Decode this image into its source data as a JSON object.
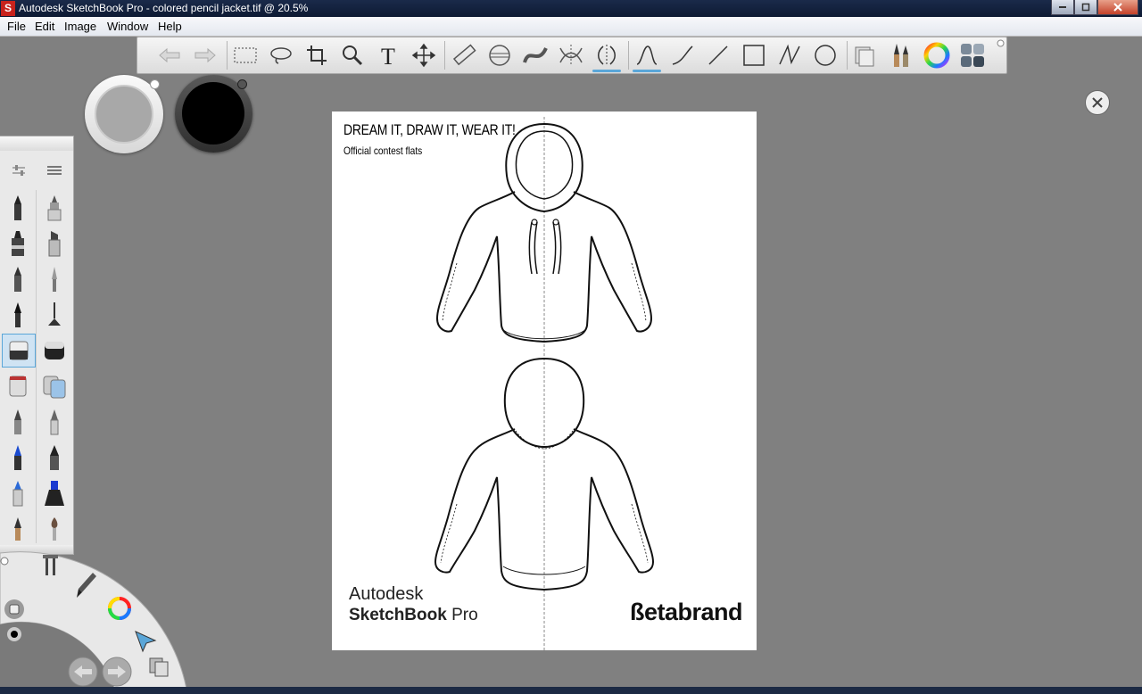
{
  "window": {
    "title": "Autodesk SketchBook Pro - colored pencil jacket.tif @ 20.5%",
    "app_icon": "S"
  },
  "menu": [
    "File",
    "Edit",
    "Image",
    "Window",
    "Help"
  ],
  "toolbar": {
    "tools": [
      "undo-icon",
      "redo-icon",
      "rect-select-icon",
      "lasso-icon",
      "crop-icon",
      "zoom-icon",
      "text-icon",
      "move-icon",
      "ruler-icon",
      "ellipse-guide-icon",
      "french-curve-icon",
      "symmetry-x-icon",
      "symmetry-y-icon",
      "freehand-stroke-icon",
      "curve-icon",
      "line-icon",
      "rectangle-icon",
      "polyline-icon",
      "circle-icon",
      "layers-icon",
      "brushes-icon",
      "color-wheel-icon",
      "copic-library-icon"
    ],
    "selected": [
      "symmetry-y-icon",
      "freehand-stroke-icon"
    ]
  },
  "colors": {
    "primary_puck": "#a8a8a8",
    "secondary_puck": "#000000",
    "accent": "#5aa6d8"
  },
  "canvas": {
    "heading": "DREAM IT, DRAW IT, WEAR IT!",
    "subheading": "Official contest flats",
    "brand_autodesk": "Autodesk",
    "brand_sketchbook": "SketchBook",
    "brand_pro": "Pro",
    "brand_beta": "ßetabrand"
  }
}
